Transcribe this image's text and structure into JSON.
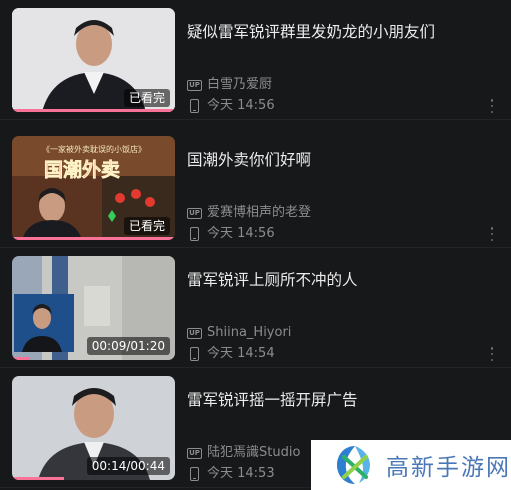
{
  "videos": [
    {
      "title": "疑似雷军锐评群里发奶龙的小朋友们",
      "uploader": "白雪乃爱厨",
      "up_label": "UP",
      "time": "今天 14:56",
      "badge": "已看完",
      "progress": 1.0
    },
    {
      "title": "国潮外卖你们好啊",
      "uploader": "爱赛博相声的老登",
      "up_label": "UP",
      "time": "今天 14:56",
      "badge": "已看完",
      "progress": 1.0,
      "thumb_caption_small": "《一家被外卖耽误的小饭店》",
      "thumb_caption_big": "国潮外卖"
    },
    {
      "title": "雷军锐评上厕所不冲的人",
      "uploader": "Shiina_Hiyori",
      "up_label": "UP",
      "time": "今天 14:54",
      "badge": "00:09/01:20",
      "progress": 0.11
    },
    {
      "title": "雷军锐评摇一摇开屏广告",
      "uploader": "陆犯焉識Studio",
      "up_label": "UP",
      "time": "今天 14:53",
      "badge": "00:14/00:44",
      "progress": 0.32
    }
  ],
  "watermark": {
    "text": "高新手游网",
    "color": "#4a78b6"
  },
  "colors": {
    "background": "#17181a",
    "accent": "#fb7299"
  },
  "icons": {
    "up": "up-badge-icon",
    "device": "phone-icon",
    "more": "more-vertical-icon"
  }
}
